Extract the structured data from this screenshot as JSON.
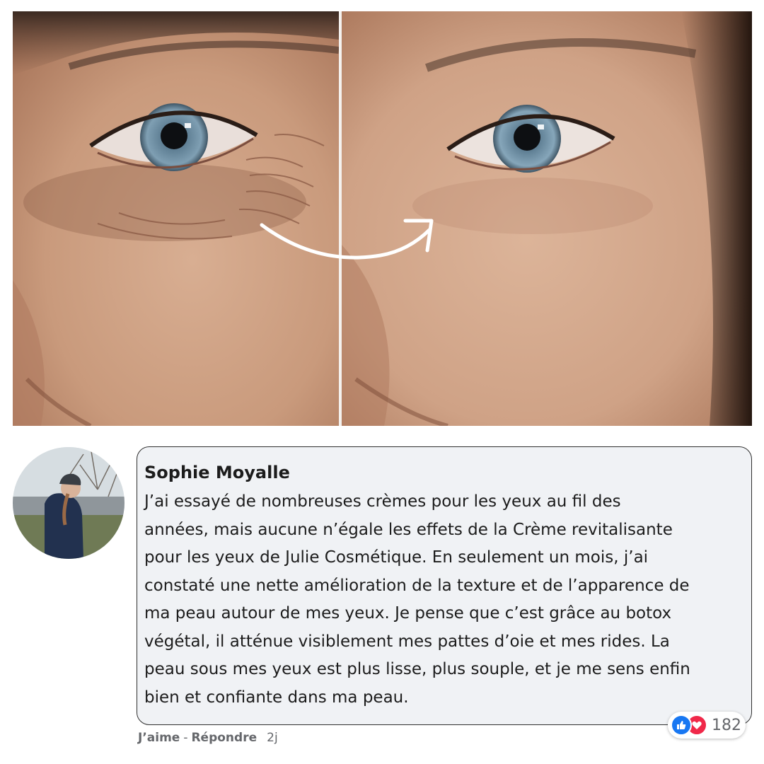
{
  "photo": {
    "before_alt": "eye-before-icon",
    "after_alt": "eye-after-icon"
  },
  "comment": {
    "author": "Sophie Moyalle",
    "text_lines": [
      "J’ai essayé de nombreuses crèmes pour les yeux au fil des",
      "années, mais aucune n’égale les effets de la Crème revitalisante",
      "pour les yeux de Julie Cosmétique. En seulement un mois, j’ai",
      "constaté une nette amélioration de la texture et de l’apparence de",
      "ma peau autour de mes yeux. Je pense que c’est grâce au botox",
      "végétal, il atténue visiblement mes pattes d’oie et mes rides. La",
      "peau sous mes yeux est plus lisse, plus souple, et je me sens enfin",
      "bien et confiante dans ma peau."
    ],
    "reaction_count": "182",
    "reaction_icons": [
      "thumbs-up-icon",
      "heart-icon"
    ],
    "actions": {
      "like": "J’aime",
      "separator": "-",
      "reply": "Répondre",
      "time": "2j"
    }
  },
  "colors": {
    "bubble_bg": "#f0f2f5",
    "like_blue": "#1877f2",
    "love_red": "#f02849",
    "meta_gray": "#65676b"
  }
}
